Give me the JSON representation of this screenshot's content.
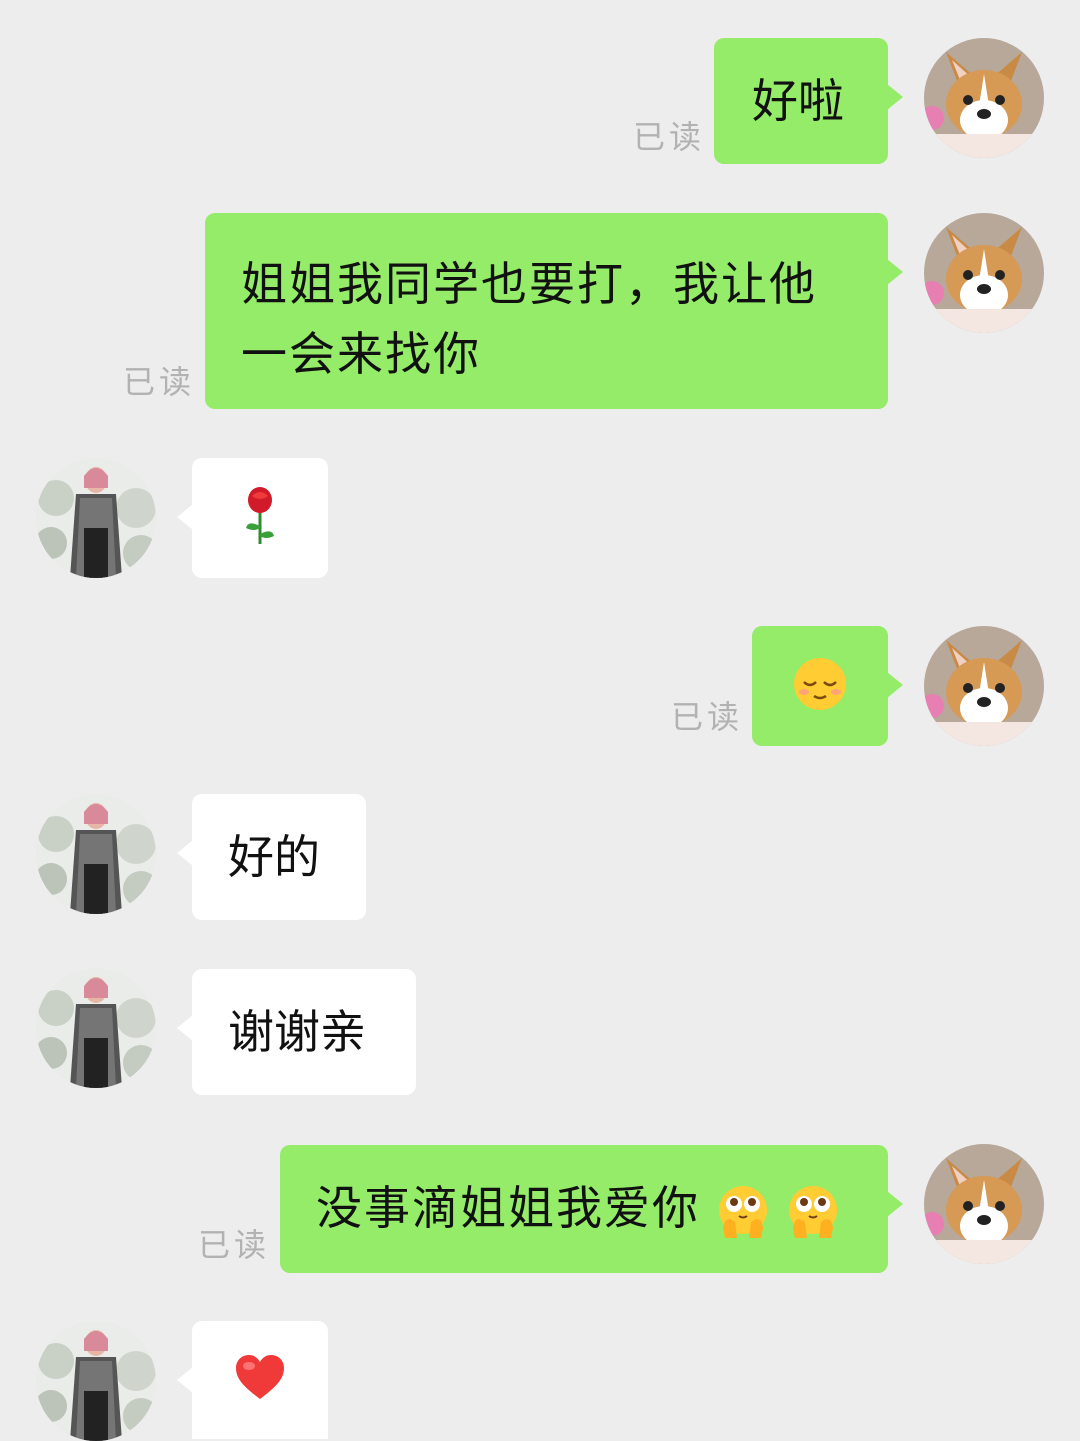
{
  "read_label": "已读",
  "messages": [
    {
      "from": "me",
      "text": "好啦",
      "status": "已读"
    },
    {
      "from": "me",
      "text_line1": "姐姐我同学也要打，我让他",
      "text_line2": "一会来找你",
      "status": "已读"
    },
    {
      "from": "other",
      "emoji": "rose-emoji"
    },
    {
      "from": "me",
      "emoji": "relieved-face-emoji",
      "status": "已读"
    },
    {
      "from": "other",
      "text": "好的"
    },
    {
      "from": "other",
      "text": "谢谢亲"
    },
    {
      "from": "me",
      "text": "没事滴姐姐我爱你",
      "emoji": [
        "pleading-hands-emoji",
        "pleading-hands-emoji"
      ],
      "status": "已读"
    },
    {
      "from": "other",
      "emoji": "red-heart-emoji"
    }
  ],
  "colors": {
    "background": "#ededed",
    "outgoing_bubble": "#95ec69",
    "incoming_bubble": "#ffffff",
    "read_text": "#b2b2b2"
  }
}
